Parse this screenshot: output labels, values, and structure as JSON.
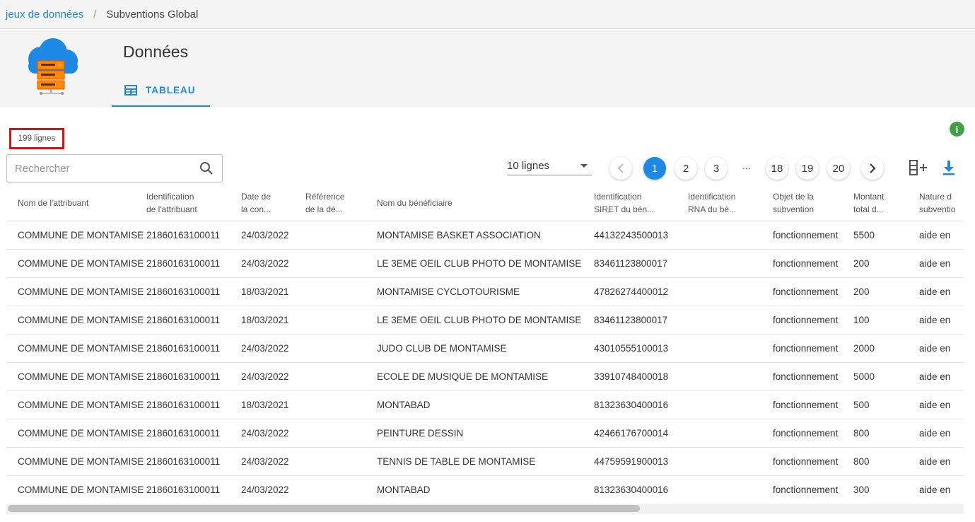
{
  "breadcrumb": {
    "root": "jeux de données",
    "separator": "/",
    "current": "Subventions Global"
  },
  "header": {
    "title": "Données",
    "tab_label": "TABLEAU"
  },
  "toolbar": {
    "row_count": "199 lignes",
    "search_placeholder": "Rechercher",
    "rows_per_page": "10 lignes",
    "info_glyph": "i"
  },
  "pagination": {
    "pages": [
      "1",
      "2",
      "3",
      "18",
      "19",
      "20"
    ],
    "ellipsis": "...",
    "current": "1"
  },
  "icons": [
    "cloud-server-logo-icon",
    "table-icon",
    "info-icon",
    "search-icon",
    "chevron-left-icon",
    "chevron-right-icon",
    "add-column-icon",
    "download-icon"
  ],
  "colors": {
    "accent": "#1e88e5",
    "info": "#43a047",
    "highlight_box": "#e01010"
  },
  "table": {
    "headers": [
      [
        "Nom de l'attribuant",
        ""
      ],
      [
        "Identification",
        "de l'attribuant"
      ],
      [
        "Date de",
        "la con..."
      ],
      [
        "Référence",
        "de la dé..."
      ],
      [
        "Nom du bénéficiaire",
        ""
      ],
      [
        "Identification",
        "SIRET du bén..."
      ],
      [
        "Identification",
        "RNA du bé..."
      ],
      [
        "Objet de la",
        "subvention"
      ],
      [
        "Montant",
        "total d..."
      ],
      [
        "Nature d",
        "subventio"
      ]
    ],
    "rows": [
      [
        "COMMUNE DE MONTAMISE",
        "21860163100011",
        "24/03/2022",
        "",
        "MONTAMISE BASKET ASSOCIATION",
        "44132243500013",
        "",
        "fonctionnement",
        "5500",
        "aide en"
      ],
      [
        "COMMUNE DE MONTAMISE",
        "21860163100011",
        "24/03/2022",
        "",
        "LE 3EME OEIL CLUB PHOTO DE MONTAMISE",
        "83461123800017",
        "",
        "fonctionnement",
        "200",
        "aide en"
      ],
      [
        "COMMUNE DE MONTAMISE",
        "21860163100011",
        "18/03/2021",
        "",
        "MONTAMISE CYCLOTOURISME",
        "47826274400012",
        "",
        "fonctionnement",
        "200",
        "aide en"
      ],
      [
        "COMMUNE DE MONTAMISE",
        "21860163100011",
        "18/03/2021",
        "",
        "LE 3EME OEIL CLUB PHOTO DE MONTAMISE",
        "83461123800017",
        "",
        "fonctionnement",
        "100",
        "aide en"
      ],
      [
        "COMMUNE DE MONTAMISE",
        "21860163100011",
        "24/03/2022",
        "",
        "JUDO CLUB DE MONTAMISE",
        "43010555100013",
        "",
        "fonctionnement",
        "2000",
        "aide en"
      ],
      [
        "COMMUNE DE MONTAMISE",
        "21860163100011",
        "24/03/2022",
        "",
        "ECOLE DE MUSIQUE DE MONTAMISE",
        "33910748400018",
        "",
        "fonctionnement",
        "5000",
        "aide en"
      ],
      [
        "COMMUNE DE MONTAMISE",
        "21860163100011",
        "18/03/2021",
        "",
        "MONTABAD",
        "81323630400016",
        "",
        "fonctionnement",
        "500",
        "aide en"
      ],
      [
        "COMMUNE DE MONTAMISE",
        "21860163100011",
        "24/03/2022",
        "",
        "PEINTURE DESSIN",
        "42466176700014",
        "",
        "fonctionnement",
        "800",
        "aide en"
      ],
      [
        "COMMUNE DE MONTAMISE",
        "21860163100011",
        "24/03/2022",
        "",
        "TENNIS DE TABLE DE MONTAMISE",
        "44759591900013",
        "",
        "fonctionnement",
        "800",
        "aide en"
      ],
      [
        "COMMUNE DE MONTAMISE",
        "21860163100011",
        "24/03/2022",
        "",
        "MONTABAD",
        "81323630400016",
        "",
        "fonctionnement",
        "300",
        "aide en"
      ]
    ]
  }
}
